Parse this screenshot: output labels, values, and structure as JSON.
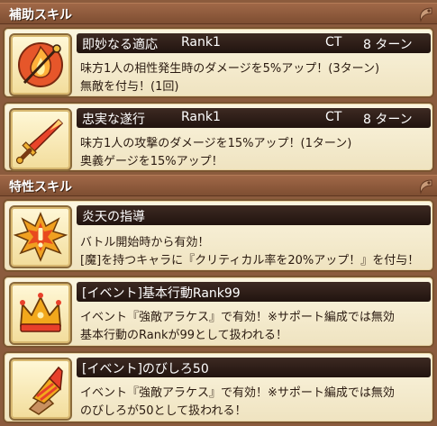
{
  "sections": {
    "support": {
      "title": "補助スキル"
    },
    "trait": {
      "title": "特性スキル"
    }
  },
  "skills": [
    {
      "name": "即妙なる適応",
      "rank": "Rank1",
      "ct_label": "CT",
      "ct_value": "8 ターン",
      "lines": [
        "味方1人の相性発生時のダメージを5%アップ！(3ターン)",
        "無敵を付与！(1回)"
      ],
      "icon": "fire-shield-icon"
    },
    {
      "name": "忠実な遂行",
      "rank": "Rank1",
      "ct_label": "CT",
      "ct_value": "8 ターン",
      "lines": [
        "味方1人の攻撃のダメージを15%アップ！(1ターン)",
        "奥義ゲージを15%アップ！"
      ],
      "icon": "sword-icon"
    }
  ],
  "traits": [
    {
      "name": "炎天の指導",
      "lines": [
        "バトル開始時から有効！",
        "[魔]を持つキャラに『クリティカル率を20%アップ！』を付与！"
      ],
      "icon": "burst-icon"
    },
    {
      "name": "[イベント]基本行動Rank99",
      "lines": [
        "イベント『強敵アラケス』で有効！※サポート編成では無効",
        "基本行動のRankが99として扱われる！"
      ],
      "icon": "crown-icon"
    },
    {
      "name": "[イベント]のびしろ50",
      "lines": [
        "イベント『強敵アラケス』で有効！※サポート編成では無効",
        "のびしろが50として扱われる！"
      ],
      "icon": "drill-icon"
    }
  ]
}
